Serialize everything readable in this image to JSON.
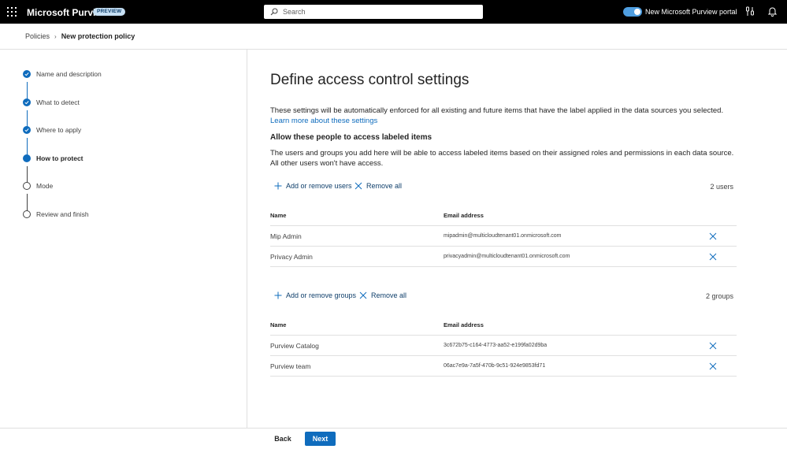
{
  "header": {
    "app_title": "Microsoft Purview",
    "badge": "PREVIEW",
    "search_placeholder": "Search",
    "portal_toggle_label": "New Microsoft Purview portal",
    "icons": [
      "app-launcher-icon",
      "search-icon",
      "settings-tool-icon",
      "bell-icon"
    ],
    "toggle_on": true
  },
  "breadcrumb": {
    "parent": "Policies",
    "current": "New protection policy"
  },
  "steps": [
    {
      "label": "Name and description",
      "state": "done"
    },
    {
      "label": "What to detect",
      "state": "done"
    },
    {
      "label": "Where to apply",
      "state": "done"
    },
    {
      "label": "How to protect",
      "state": "current"
    },
    {
      "label": "Mode",
      "state": "todo"
    },
    {
      "label": "Review and finish",
      "state": "todo"
    }
  ],
  "main": {
    "title": "Define access control settings",
    "intro": "These settings will be automatically enforced for all existing and future items that have the label applied in the data sources you selected.",
    "learn_more": "Learn more about these settings",
    "section_heading": "Allow these people to access labeled items",
    "section_desc_line1": "The users and groups you add here will be able to access labeled items based on their assigned roles and permissions in each data source.",
    "section_desc_line2": "All other users won't have access.",
    "users": {
      "add_label": "Add or remove users",
      "remove_all_label": "Remove all",
      "count": "2 users",
      "col_name": "Name",
      "col_email": "Email address",
      "rows": [
        {
          "name": "Mip Admin",
          "email": "mipadmin@multicloudtenant01.onmicrosoft.com"
        },
        {
          "name": "Privacy Admin",
          "email": "privacyadmin@multicloudtenant01.onmicrosoft.com"
        }
      ]
    },
    "groups": {
      "add_label": "Add or remove groups",
      "remove_all_label": "Remove all",
      "count": "2 groups",
      "col_name": "Name",
      "col_email": "Email address",
      "rows": [
        {
          "name": "Purview Catalog",
          "email": "3c672b75-c164-4773-aa52-e199fa02d9ba"
        },
        {
          "name": "Purview team",
          "email": "06ac7e9a-7a5f-470b-9c51-924e9853fd71"
        }
      ]
    }
  },
  "footer": {
    "back_label": "Back",
    "next_label": "Next"
  },
  "colors": {
    "accent": "#0f6cbd",
    "topbar": "#000000",
    "toggle": "#4f9ee0"
  }
}
